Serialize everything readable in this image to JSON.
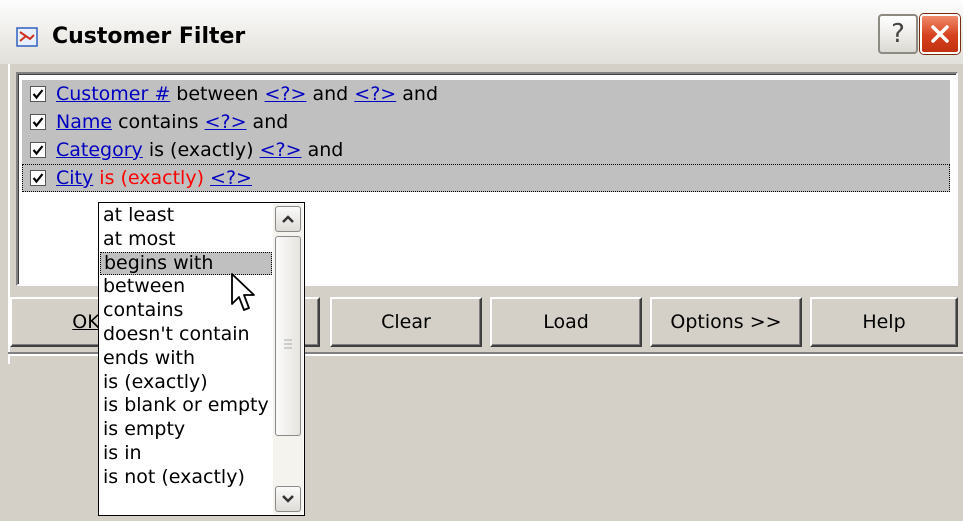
{
  "window": {
    "title": "Customer Filter"
  },
  "conditions": [
    {
      "field": "Customer #",
      "parts": [
        " between ",
        "<?>",
        " and ",
        "<?>",
        " and"
      ]
    },
    {
      "field": "Name",
      "parts": [
        " contains ",
        "<?>",
        " and"
      ]
    },
    {
      "field": "Category",
      "parts": [
        " is (exactly) ",
        "<?>",
        " and"
      ]
    },
    {
      "field": "City",
      "operator": " is (exactly) ",
      "placeholder": "<?>"
    }
  ],
  "buttons": {
    "ok": "OK",
    "clear": "Clear",
    "load": "Load",
    "options": "Options >>",
    "help": "Help"
  },
  "operator_list": {
    "items": [
      "at least",
      "at most",
      "begins with",
      "between",
      "contains",
      "doesn't contain",
      "ends with",
      "is (exactly)",
      "is blank or empty",
      "is empty",
      "is in",
      "is not (exactly)"
    ],
    "selected": "begins with"
  },
  "icons": {
    "title": "filter-app-icon",
    "help": "question-icon",
    "close": "close-icon",
    "scroll_up": "chevron-up-icon",
    "scroll_down": "chevron-down-icon",
    "cursor": "mouse-pointer-icon"
  }
}
